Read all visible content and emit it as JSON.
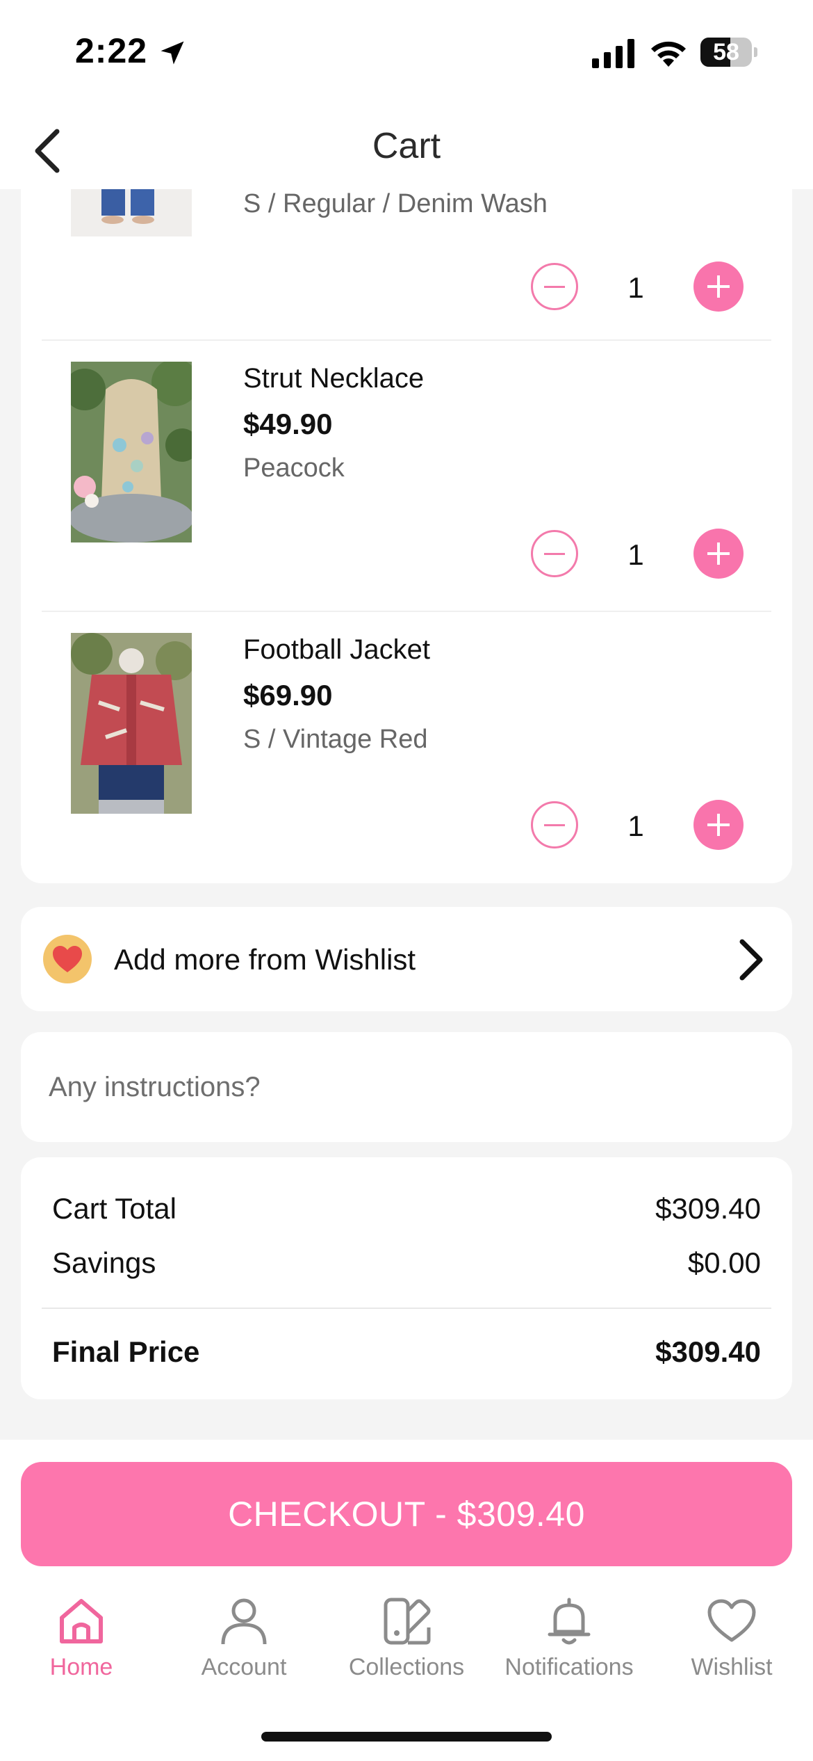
{
  "status_bar": {
    "time": "2:22",
    "battery": "58",
    "battery_level": 0.58
  },
  "header": {
    "title": "Cart"
  },
  "cart": {
    "items": [
      {
        "name": "",
        "price": "",
        "variant": "S / Regular / Denim Wash",
        "quantity": "1"
      },
      {
        "name": "Strut Necklace",
        "price": "$49.90",
        "variant": "Peacock",
        "quantity": "1"
      },
      {
        "name": "Football Jacket",
        "price": "$69.90",
        "variant": "S / Vintage Red",
        "quantity": "1"
      }
    ]
  },
  "wishlist": {
    "label": "Add more from Wishlist"
  },
  "instructions": {
    "placeholder": "Any instructions?"
  },
  "summary": {
    "cart_total_label": "Cart Total",
    "cart_total": "$309.40",
    "savings_label": "Savings",
    "savings": "$0.00",
    "final_label": "Final Price",
    "final": "$309.40"
  },
  "checkout": {
    "label": "CHECKOUT - $309.40"
  },
  "tabs": [
    {
      "label": "Home",
      "icon": "home-icon",
      "active": true
    },
    {
      "label": "Account",
      "icon": "account-icon",
      "active": false
    },
    {
      "label": "Collections",
      "icon": "collections-icon",
      "active": false
    },
    {
      "label": "Notifications",
      "icon": "bell-icon",
      "active": false
    },
    {
      "label": "Wishlist",
      "icon": "heart-icon",
      "active": false
    }
  ],
  "colors": {
    "accent": "#fd76ad",
    "accent_text": "#f0669d",
    "muted": "#8b8b8b"
  }
}
